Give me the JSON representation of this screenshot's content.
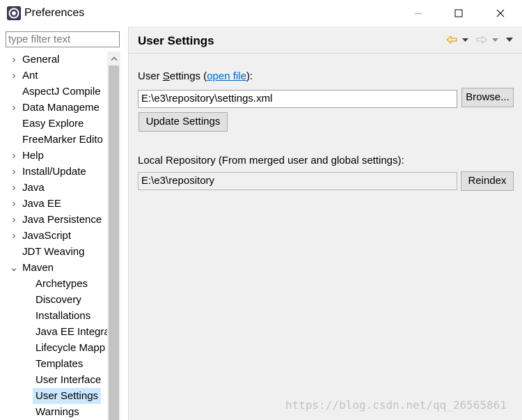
{
  "window": {
    "title": "Preferences"
  },
  "filter": {
    "placeholder": "type filter text",
    "value": ""
  },
  "tree": {
    "items": [
      {
        "label": "General",
        "expandable": true
      },
      {
        "label": "Ant",
        "expandable": true
      },
      {
        "label": "AspectJ Compile",
        "expandable": false
      },
      {
        "label": "Data Manageme",
        "expandable": true
      },
      {
        "label": "Easy Explore",
        "expandable": false
      },
      {
        "label": "FreeMarker Edito",
        "expandable": false
      },
      {
        "label": "Help",
        "expandable": true
      },
      {
        "label": "Install/Update",
        "expandable": true
      },
      {
        "label": "Java",
        "expandable": true
      },
      {
        "label": "Java EE",
        "expandable": true
      },
      {
        "label": "Java Persistence",
        "expandable": true
      },
      {
        "label": "JavaScript",
        "expandable": true
      },
      {
        "label": "JDT Weaving",
        "expandable": false
      },
      {
        "label": "Maven",
        "expandable": true,
        "expanded": true
      },
      {
        "label": "Archetypes",
        "child": true
      },
      {
        "label": "Discovery",
        "child": true
      },
      {
        "label": "Installations",
        "child": true
      },
      {
        "label": "Java EE Integra",
        "child": true
      },
      {
        "label": "Lifecycle Mapp",
        "child": true
      },
      {
        "label": "Templates",
        "child": true
      },
      {
        "label": "User Interface",
        "child": true
      },
      {
        "label": "User Settings",
        "child": true,
        "selected": true
      },
      {
        "label": "Warnings",
        "child": true
      }
    ]
  },
  "page": {
    "title": "User Settings",
    "user_settings_prefix": "User ",
    "user_settings_mnemonic": "S",
    "user_settings_rest": "ettings (",
    "open_file_link": "open file",
    "user_settings_suffix": "):",
    "settings_file_value": "E:\\e3\\repository\\settings.xml",
    "browse_label": "Browse...",
    "update_settings_label": "Update Settings",
    "local_repo_label": "Local Repository (From merged user and global settings):",
    "local_repo_value": "E:\\e3\\repository",
    "reindex_label": "Reindex"
  },
  "watermark": "https://blog.csdn.net/qq_26565861",
  "colors": {
    "selection": "#cce8ff",
    "link": "#0066cc",
    "back_arrow": "#e0a020"
  }
}
